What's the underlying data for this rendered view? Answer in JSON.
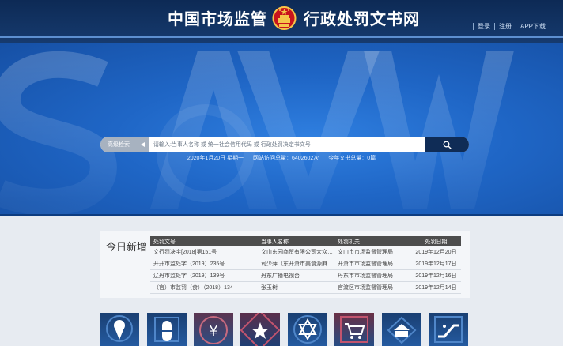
{
  "header": {
    "title_left": "中国市场监管",
    "title_right": "行政处罚文书网",
    "links": [
      "登录",
      "注册",
      "APP下载"
    ]
  },
  "banner": {
    "date": "2020年1月20日 星期一",
    "visits": "网站访问总量：6402602次",
    "docs": "今年文书总量：0篇"
  },
  "search": {
    "advanced_label": "高级检索",
    "placeholder": "请输入:当事人名称 或 统一社会信用代码 或 行政处罚决定书文号"
  },
  "today": {
    "title": "今日新增",
    "columns": [
      "处罚文号",
      "当事人名称",
      "处罚机关",
      "处罚日期"
    ],
    "rows": [
      [
        "文行罚决字[2018]第151号",
        "文山东园商贸有限公司大众超市",
        "文山市市场监督管理局",
        "2019年12月20日"
      ],
      [
        "开开市监处字（2019）235号",
        "司少萍（东开萧市美食源麻辣店）",
        "开萧市市场监督管理局",
        "2019年12月17日"
      ],
      [
        "辽丹市监处字（2019）139号",
        "丹东广播电视台",
        "丹东市市场监督管理局",
        "2019年12月16日"
      ],
      [
        "（官）市监罚（食）（2018）134",
        "张玉树",
        "官渡区市场监督管理局",
        "2019年12月14日"
      ]
    ]
  },
  "tiles": [
    "ice-cream-icon",
    "pill-icon",
    "yen-icon",
    "star-icon",
    "hexagram-icon",
    "shopping-cart-icon",
    "building-icon",
    "escalator-icon"
  ],
  "colors": {
    "header_bg": "#0d2a55",
    "banner_blue": "#1f66c6",
    "search_btn": "#0f2c56",
    "table_head": "#4d4d4d"
  }
}
